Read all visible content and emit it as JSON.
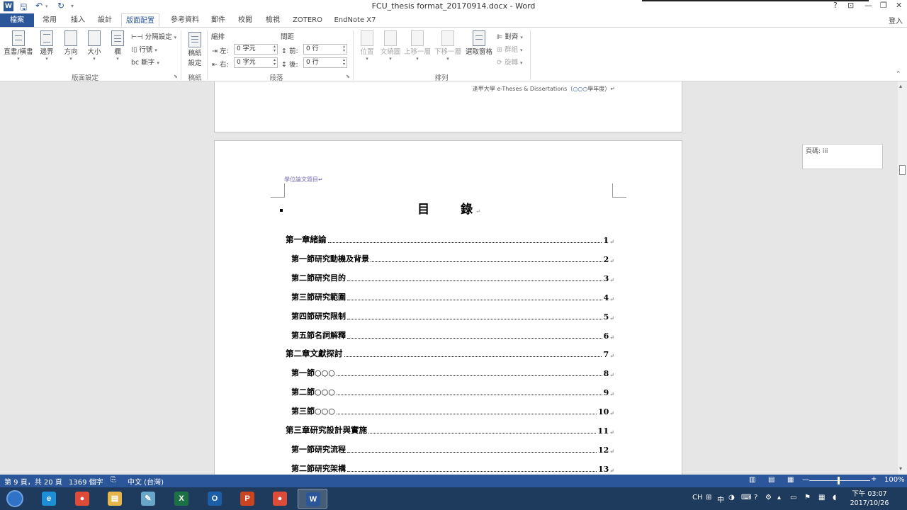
{
  "title_bar": {
    "app_logo": "W",
    "document_title": "FCU_thesis format_20170914.docx - Word",
    "save_icon": "floppy-icon",
    "undo_icon": "undo-icon",
    "redo_icon": "redo-icon",
    "window_buttons": [
      "?",
      "⊡",
      "—",
      "❐",
      "✕"
    ]
  },
  "tabs": [
    "檔案",
    "常用",
    "插入",
    "設計",
    "版面配置",
    "參考資料",
    "郵件",
    "校閱",
    "檢視",
    "ZOTERO",
    "EndNote X7"
  ],
  "active_tab": "版面配置",
  "signin": "登入",
  "ribbon": {
    "page_setup": {
      "text_direction": "直書/橫書",
      "margins": "邊界",
      "orientation": "方向",
      "size": "大小",
      "columns": "欄",
      "breaks": "分隔設定",
      "line_numbers": "行號",
      "hyphenation": "斷字",
      "group_label": "版面設定"
    },
    "draft": {
      "button": "稿紙\n設定",
      "line1": "稿紙",
      "line2": "設定",
      "group_label": "稿紙"
    },
    "paragraph": {
      "indent_label": "縮排",
      "spacing_label": "間距",
      "left_label": "左:",
      "left_value": "0 字元",
      "right_label": "右:",
      "right_value": "0 字元",
      "before_label": "前:",
      "before_value": "0 行",
      "after_label": "後:",
      "after_value": "0 行",
      "group_label": "段落"
    },
    "arrange": {
      "position": "位置",
      "wrap_text": "文繞圖",
      "bring_forward": "上移一層",
      "send_backward": "下移一層",
      "selection_pane": "選取窗格",
      "align": "對齊",
      "group": "群組",
      "rotate": "旋轉",
      "group_label": "排列"
    }
  },
  "document": {
    "prev_page_header": "逢甲大學 e-Theses & Dissertations（",
    "prev_page_header_ooo": "○○○",
    "prev_page_header_end": "學年度）",
    "page_header": "學位論文題目",
    "toc_title_1": "目",
    "toc_title_2": "錄",
    "toc": [
      {
        "title": "第一章緒論",
        "page": "1",
        "level": 1
      },
      {
        "title": "第一節研究動機及背景",
        "page": "2",
        "level": 2
      },
      {
        "title": "第二節研究目的",
        "page": "3",
        "level": 2
      },
      {
        "title": "第三節研究範圍",
        "page": "4",
        "level": 2
      },
      {
        "title": "第四節研究限制",
        "page": "5",
        "level": 2
      },
      {
        "title": "第五節名詞解釋",
        "page": "6",
        "level": 2
      },
      {
        "title": "第二章文獻探討",
        "page": "7",
        "level": 1
      },
      {
        "title": "第一節○○○",
        "page": "8",
        "level": 2
      },
      {
        "title": "第二節○○○",
        "page": "9",
        "level": 2
      },
      {
        "title": "第三節○○○",
        "page": "10",
        "level": 2
      },
      {
        "title": "第三章研究設計與實施",
        "page": "11",
        "level": 1
      },
      {
        "title": "第一節研究流程",
        "page": "12",
        "level": 2
      },
      {
        "title": "第二節研究架構",
        "page": "13",
        "level": 2
      }
    ],
    "paragraph_mark": "↵",
    "comment": "頁碼: iii"
  },
  "status_bar": {
    "page": "第 9 頁，共 20 頁",
    "words": "1369 個字",
    "language": "中文 (台灣)",
    "zoom": "100%",
    "zoom_minus": "—",
    "zoom_plus": "+"
  },
  "taskbar": {
    "apps": [
      {
        "name": "ie",
        "color": "#1d8fd6",
        "label": "e"
      },
      {
        "name": "chrome",
        "color": "#dd4b39",
        "label": "●"
      },
      {
        "name": "explorer",
        "color": "#e6b64a",
        "label": "▤"
      },
      {
        "name": "tablet",
        "color": "#6aa6c8",
        "label": "✎"
      },
      {
        "name": "excel",
        "color": "#1e7145",
        "label": "X"
      },
      {
        "name": "outlook",
        "color": "#1c5fa8",
        "label": "O"
      },
      {
        "name": "powerpoint",
        "color": "#c94420",
        "label": "P"
      },
      {
        "name": "chrome2",
        "color": "#dd4b39",
        "label": "●"
      },
      {
        "name": "word",
        "color": "#2b579a",
        "label": "W"
      }
    ],
    "tray_lang": "CH",
    "tray_ime": "中",
    "clock_time": "下午 03:07",
    "clock_date": "2017/10/26"
  }
}
